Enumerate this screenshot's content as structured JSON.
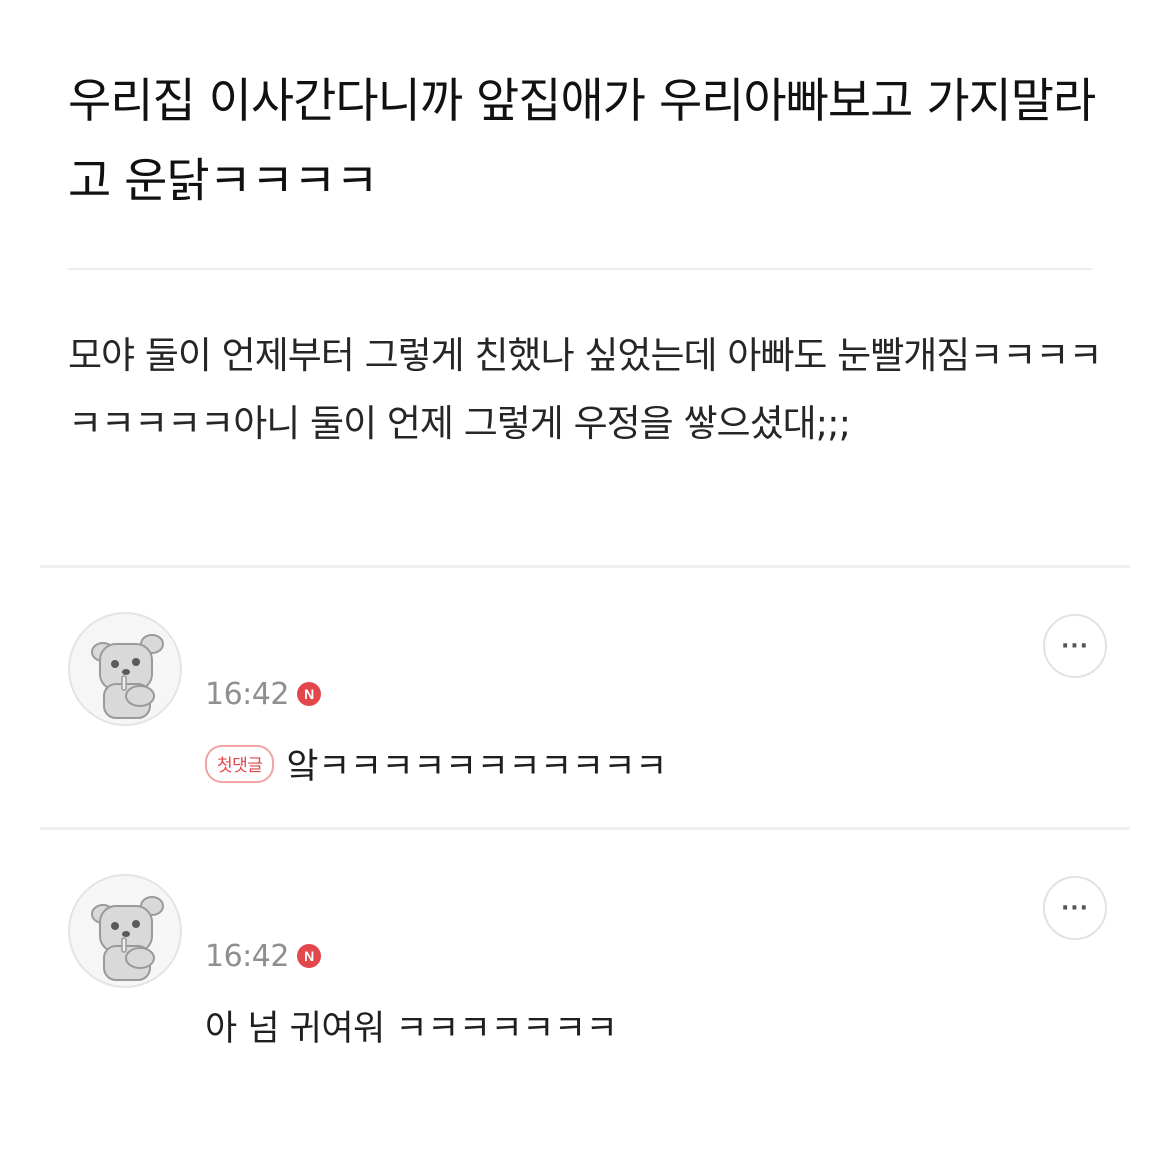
{
  "post": {
    "title": "우리집 이사간다니까 앞집애가 우리아빠보고 가지말라고 운닭ㅋㅋㅋㅋ",
    "body": "모야 둘이 언제부터 그렇게 친했나 싶었는데 아빠도 눈빨개짐ㅋㅋㅋㅋㅋㅋㅋㅋㅋ아니 둘이 언제 그렇게 우정을 쌓으셨대;;;"
  },
  "comments": [
    {
      "time": "16:42",
      "new_badge": "N",
      "first_badge": "첫댓글",
      "text": "앜ㅋㅋㅋㅋㅋㅋㅋㅋㅋㅋㅋ",
      "more": "···",
      "avatar_icon": "bear-avatar-icon"
    },
    {
      "time": "16:42",
      "new_badge": "N",
      "text": "아 넘 귀여워 ㅋㅋㅋㅋㅋㅋㅋ",
      "more": "···",
      "avatar_icon": "bear-avatar-icon"
    }
  ],
  "colors": {
    "new_badge": "#e2474b",
    "first_badge_border": "#f1a3a5",
    "timestamp": "#8f8f8f",
    "divider": "#ececec"
  }
}
